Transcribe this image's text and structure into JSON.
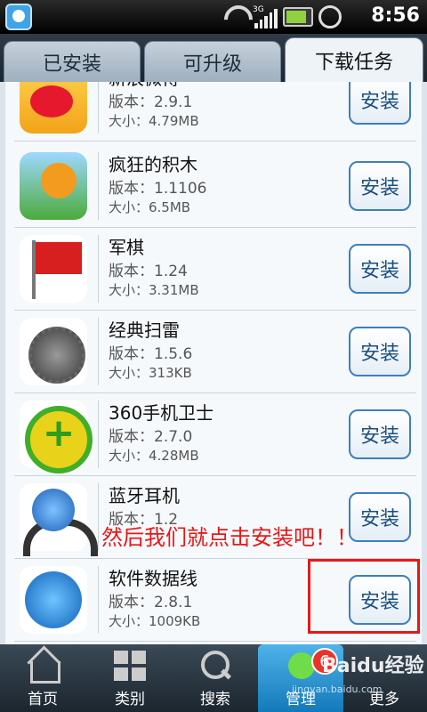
{
  "status_bar": {
    "time": "8:56",
    "network_label": "3G"
  },
  "tabs": [
    {
      "label": "已安装"
    },
    {
      "label": "可升级"
    },
    {
      "label": "下载任务"
    }
  ],
  "apps": [
    {
      "name": "新浪微博",
      "version": "版本：2.9.1",
      "size": "大小：4.79MB",
      "button": "安装"
    },
    {
      "name": "疯狂的积木",
      "version": "版本：1.1106",
      "size": "大小：6.5MB",
      "button": "安装"
    },
    {
      "name": "军棋",
      "version": "版本：1.24",
      "size": "大小：3.31MB",
      "button": "安装"
    },
    {
      "name": "经典扫雷",
      "version": "版本：1.5.6",
      "size": "大小：313KB",
      "button": "安装"
    },
    {
      "name": "360手机卫士",
      "version": "版本：2.7.0",
      "size": "大小：4.28MB",
      "button": "安装"
    },
    {
      "name": "蓝牙耳机",
      "version": "版本：1.2",
      "size": "",
      "button": "安装"
    },
    {
      "name": "软件数据线",
      "version": "版本：2.8.1",
      "size": "大小：1009KB",
      "button": "安装"
    }
  ],
  "annotation": {
    "caption": "然后我们就点击安装吧！！"
  },
  "bottom_nav": [
    {
      "label": "首页"
    },
    {
      "label": "类别"
    },
    {
      "label": "搜索"
    },
    {
      "label": "管理"
    },
    {
      "label": "更多"
    }
  ],
  "badge": {
    "count": "6"
  },
  "watermark": {
    "text": "Baidu经验",
    "url": "jingyan.baidu.com"
  }
}
